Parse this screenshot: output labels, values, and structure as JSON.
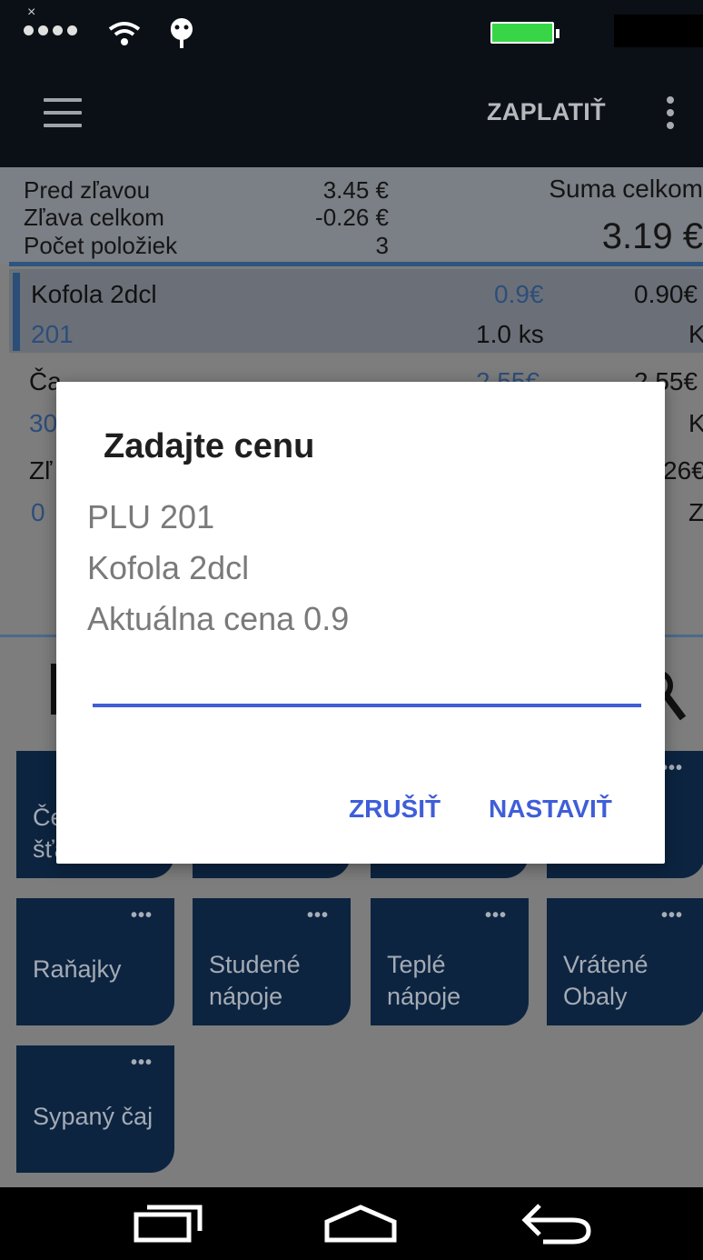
{
  "topbar": {
    "pay_label": "ZAPLATIŤ"
  },
  "summary": {
    "before_discount_label": "Pred zľavou",
    "before_discount_value": "3.45 €",
    "discount_label": "Zľava celkom",
    "discount_value": "-0.26 €",
    "items_count_label": "Počet položiek",
    "items_count_value": "3",
    "total_label": "Suma celkom",
    "total_value": "3.19 €"
  },
  "items": [
    {
      "name": "Kofola 2dcl",
      "code": "201",
      "unit_price": "0.9€",
      "qty": "1.0 ks",
      "total": "0.90€",
      "suffix": "K"
    },
    {
      "name": "Ča",
      "code": "30",
      "unit_price": "2.55€",
      "qty": "",
      "total": "2.55€",
      "suffix": "K"
    },
    {
      "name": "Zľ",
      "code": "0",
      "unit_price": "",
      "qty": "",
      "total": "26€",
      "suffix": "Z"
    }
  ],
  "categories": [
    {
      "label_line1": "Če",
      "label_line2": "šťa"
    },
    {
      "label_line1": "",
      "label_line2": ""
    },
    {
      "label_line1": "",
      "label_line2": ""
    },
    {
      "label_line1": "",
      "label_line2": ""
    },
    {
      "label_line1": "Raňajky",
      "label_line2": ""
    },
    {
      "label_line1": "Studené",
      "label_line2": "nápoje"
    },
    {
      "label_line1": "Teplé",
      "label_line2": "nápoje"
    },
    {
      "label_line1": "Vrátené",
      "label_line2": "Obaly"
    },
    {
      "label_line1": "Sypaný čaj",
      "label_line2": ""
    }
  ],
  "tile_more": "•••",
  "dialog": {
    "title": "Zadajte cenu",
    "plu": "PLU 201",
    "product": "Kofola 2dcl",
    "current_price": "Aktuálna cena 0.9",
    "input_value": "",
    "cancel_label": "ZRUŠIŤ",
    "confirm_label": "NASTAVIŤ"
  },
  "status": {
    "x_mark": "×"
  }
}
